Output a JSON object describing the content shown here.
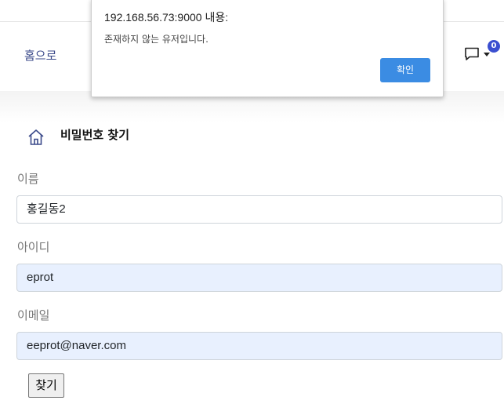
{
  "navbar": {
    "home_label": "홈으로",
    "message_badge": "0"
  },
  "page": {
    "title": "비밀번호 찾기"
  },
  "form": {
    "name_label": "이름",
    "name_value": "홍길동2",
    "id_label": "아이디",
    "id_value": "eprot",
    "email_label": "이메일",
    "email_value": "eeprot@naver.com",
    "submit_label": "찾기"
  },
  "dialog": {
    "title": "192.168.56.73:9000 내용:",
    "message": "존재하지 않는 유저입니다.",
    "ok_label": "확인"
  },
  "colors": {
    "accent": "#3b8ce3",
    "badge": "#3b4fd0",
    "autofill_bg": "#e8f0fe"
  },
  "icons": [
    "home-icon",
    "message-icon",
    "caret-down-icon"
  ]
}
